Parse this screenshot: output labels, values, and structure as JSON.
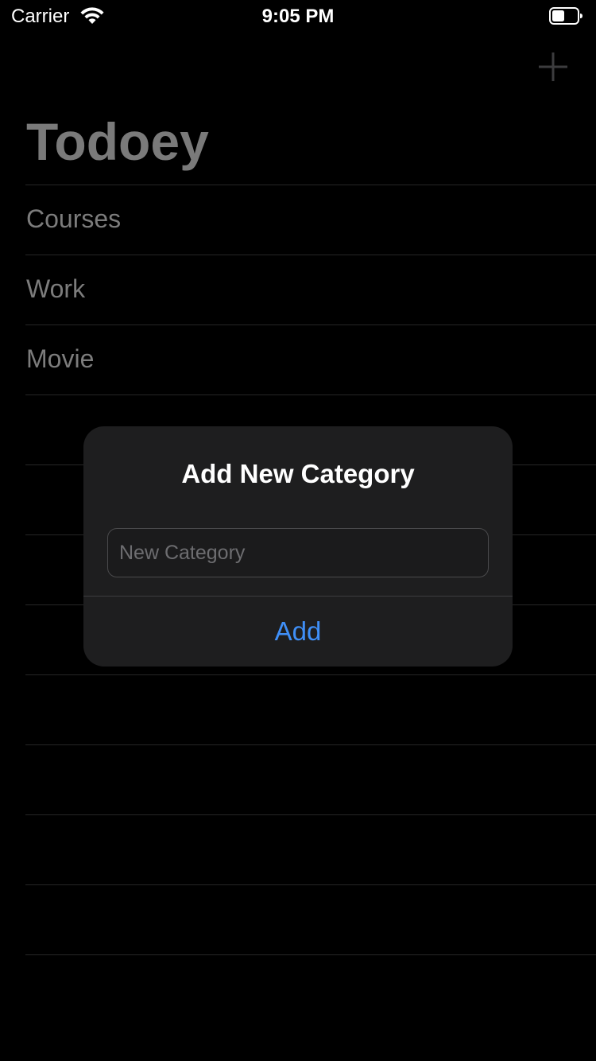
{
  "status_bar": {
    "carrier": "Carrier",
    "time": "9:05 PM",
    "wifi_icon": "wifi-icon",
    "battery_icon": "battery-icon"
  },
  "nav": {
    "title": "Todoey",
    "add_icon": "plus-icon"
  },
  "categories": [
    "Courses",
    "Work",
    "Movie",
    "",
    "",
    "",
    "",
    "",
    "",
    "",
    "",
    "",
    ""
  ],
  "alert": {
    "title": "Add New Category",
    "input_placeholder": "New Category",
    "input_value": "",
    "action_label": "Add"
  },
  "colors": {
    "background": "#000000",
    "accent": "#3f8ff7",
    "alert_background": "#1e1e1f"
  }
}
